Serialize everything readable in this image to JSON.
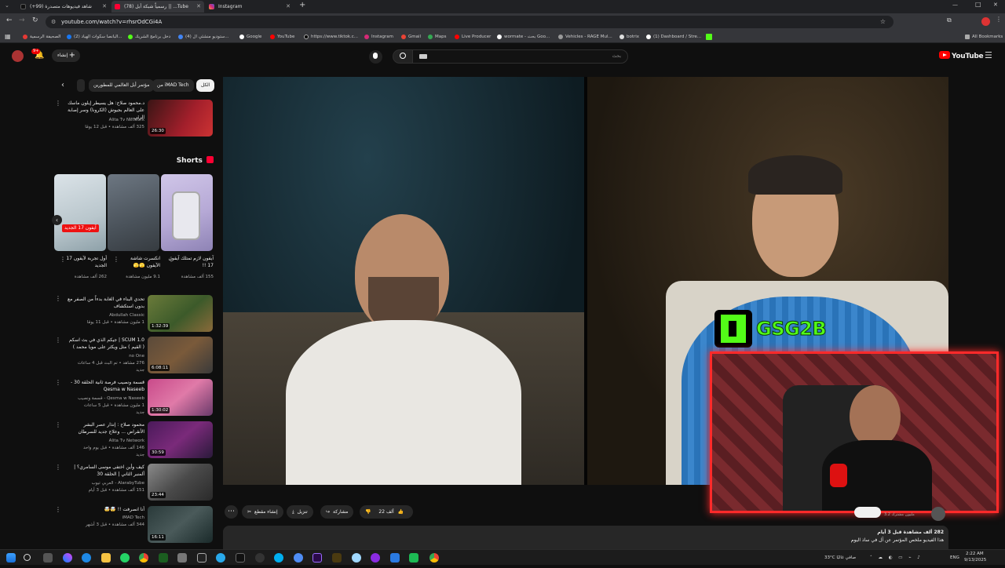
{
  "browser": {
    "tabs": [
      {
        "title": "شاهد فيديوهات متصدرة (99+)",
        "active": false
      },
      {
        "title": "(78) رسمياً شبكة أبل || ...Tube",
        "active": true
      },
      {
        "title": "Instagram",
        "active": false
      }
    ],
    "url": "youtube.com/watch?v=rhsrOdCGi4A",
    "bookmarks": [
      "الصحيفة الرسمية",
      "(2) البانصا سكوات الهياد...",
      "دخل برنامج الشريك",
      "(4) ستوديو منشئي ال...",
      "Google",
      "YouTube",
      "https://www.tiktok.c...",
      "Instagram",
      "Gmail",
      "Maps",
      "Live Producer",
      "wormate - بحث Goo...",
      "Vehicles - RAGE Mul...",
      "botrix",
      "(1) Dashboard / Stre...",
      "All Bookmarks"
    ],
    "win_buttons": [
      "—",
      "□",
      "✕"
    ]
  },
  "youtube": {
    "logo_text": "YouTube",
    "search_placeholder": "بحث",
    "create_label": "إنشاء",
    "notif_count": "9+"
  },
  "chips": [
    "الكل",
    "من iMAD Tech",
    "مؤتمر أبل العالمي للمطورين"
  ],
  "shorts_label": "Shorts",
  "top_video": {
    "title": "د.محمود صلاح: هل يسيطر إيلون ماسك على العالم بجيوش (الكرونا) وسر إصابة الرئي...",
    "channel": "Alita Tv Network",
    "meta": "325 ألف مشاهدة • قبل 12 يومًا",
    "duration": "26:30"
  },
  "shorts": [
    {
      "title": "آيفون لازم تمتلك آيفون 17 !!",
      "views": "155 ألف مشاهدة"
    },
    {
      "title": "انكسرت شاشة الآيفون 🫣🫣",
      "views": "9.1 مليون مشاهدة"
    },
    {
      "title": "أول تجربة لآيفون 17 الجديد",
      "views": "262 ألف مشاهدة",
      "badge": "آيفون 17 الجديد"
    }
  ],
  "videos": [
    {
      "title": "تحدي البناء في الغابة بدءاً من الصفر مع بدون استكشاف",
      "channel": "Abdullah Classic",
      "meta": "1 مليون مشاهدة • قبل 11 يومًا",
      "duration": "1:32:39"
    },
    {
      "title": "SCUM 1.0 | جيكم الذي في بث اسكم ( القيم ) مثل ويكثر على مويا محمد )",
      "channel": "no One",
      "meta": "276 مشاهد • تم البث قبل 4 ساعات",
      "duration": "6:08:11",
      "badge": "جديد"
    },
    {
      "title": "قسمة ونصيب فرصة ثانية الحلقة 30 - Qesma w Naseeb",
      "channel": "Qesma w Naseeb - قسمة ونصيب",
      "meta": "1 مليون مشاهدة • قبل 5 ساعات",
      "duration": "1:30:02",
      "badge": "جديد"
    },
    {
      "title": "محمود صلاح : إنذار عصر البشر الأنقراض ... وعلاج جديد للسرطان",
      "channel": "Alita Tv Network",
      "meta": "146 ألف مشاهدة • قبل يوم واحد",
      "duration": "30:59",
      "badge": "جديد"
    },
    {
      "title": "كيف وأين اختفى موسى السامري؟ | ألمنبر الثاني | الحلقة 30",
      "channel": "AlarabyTube - العربي تيوب",
      "meta": "151 ألف مشاهدة • قبل 3 أيام",
      "duration": "23:44"
    },
    {
      "title": "أنا انصرفت !! 🤯🤯",
      "channel": "iMAD Tech",
      "meta": "344 ألف مشاهدة • قبل 3 أشهر",
      "duration": "16:11"
    }
  ],
  "actions": {
    "like": "22 ألف",
    "share": "مشاركة",
    "download": "تنزيل",
    "clip": "إنشاء مقطع"
  },
  "channel_subs": "3.2 مليون مشترك",
  "description": {
    "stats": "282 ألف مشاهدة قبل 3 أيام",
    "text": "هذا الفيديو ملخص المؤتمر عن آل في ساذ اليوم"
  },
  "overlay": {
    "streamer": "GSG2B"
  },
  "taskbar": {
    "weather": "33°C صافي غالبًا",
    "lang": "ENG",
    "time": "2:22 AM",
    "date": "9/13/2025"
  }
}
